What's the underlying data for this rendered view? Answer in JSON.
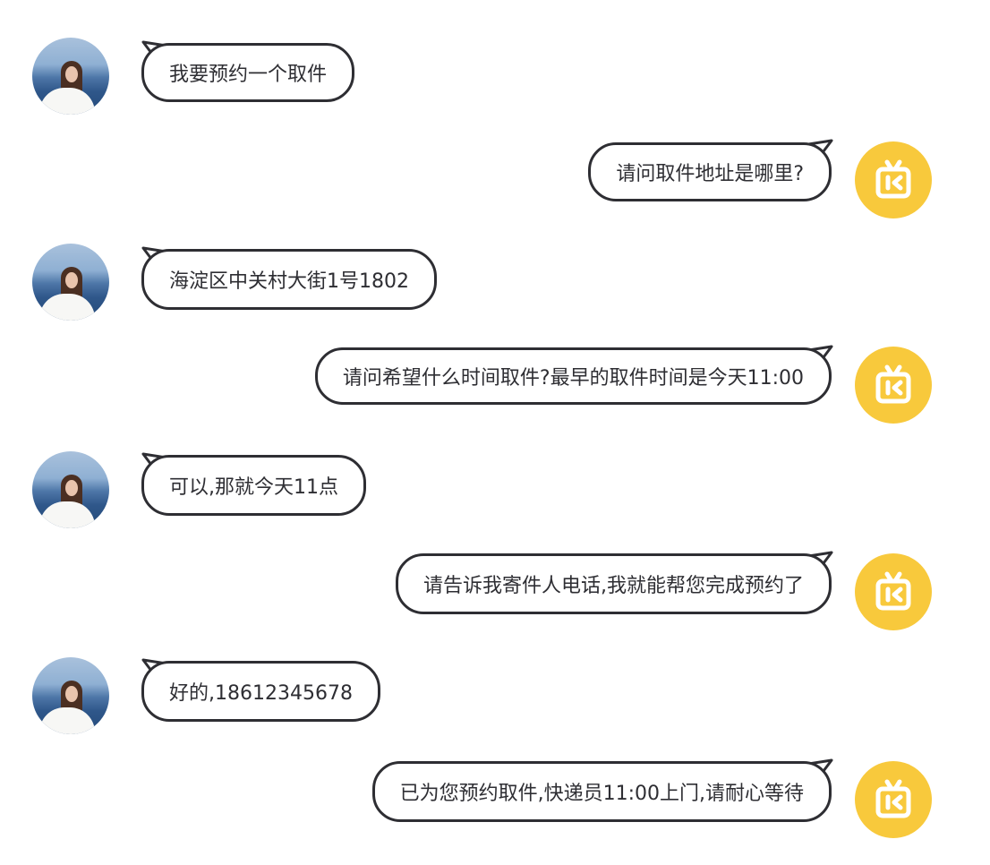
{
  "chat": {
    "messages": [
      {
        "sender": "user",
        "text": "我要预约一个取件"
      },
      {
        "sender": "bot",
        "text": "请问取件地址是哪里?"
      },
      {
        "sender": "user",
        "text": "海淀区中关村大街1号1802"
      },
      {
        "sender": "bot",
        "text": "请问希望什么时间取件?最早的取件时间是今天11:00"
      },
      {
        "sender": "user",
        "text": "可以,那就今天11点"
      },
      {
        "sender": "bot",
        "text": "请告诉我寄件人电话,我就能帮您完成预约了"
      },
      {
        "sender": "user",
        "text": "好的,18612345678"
      },
      {
        "sender": "bot",
        "text": "已为您预约取件,快递员11:00上门,请耐心等待"
      }
    ]
  },
  "colors": {
    "bubble_border": "#2e2e33",
    "bot_avatar": "#f8c93c",
    "text": "#2e2e33"
  },
  "icons": {
    "user_avatar": "photo-avatar-icon",
    "bot_avatar": "tv-robot-icon"
  }
}
